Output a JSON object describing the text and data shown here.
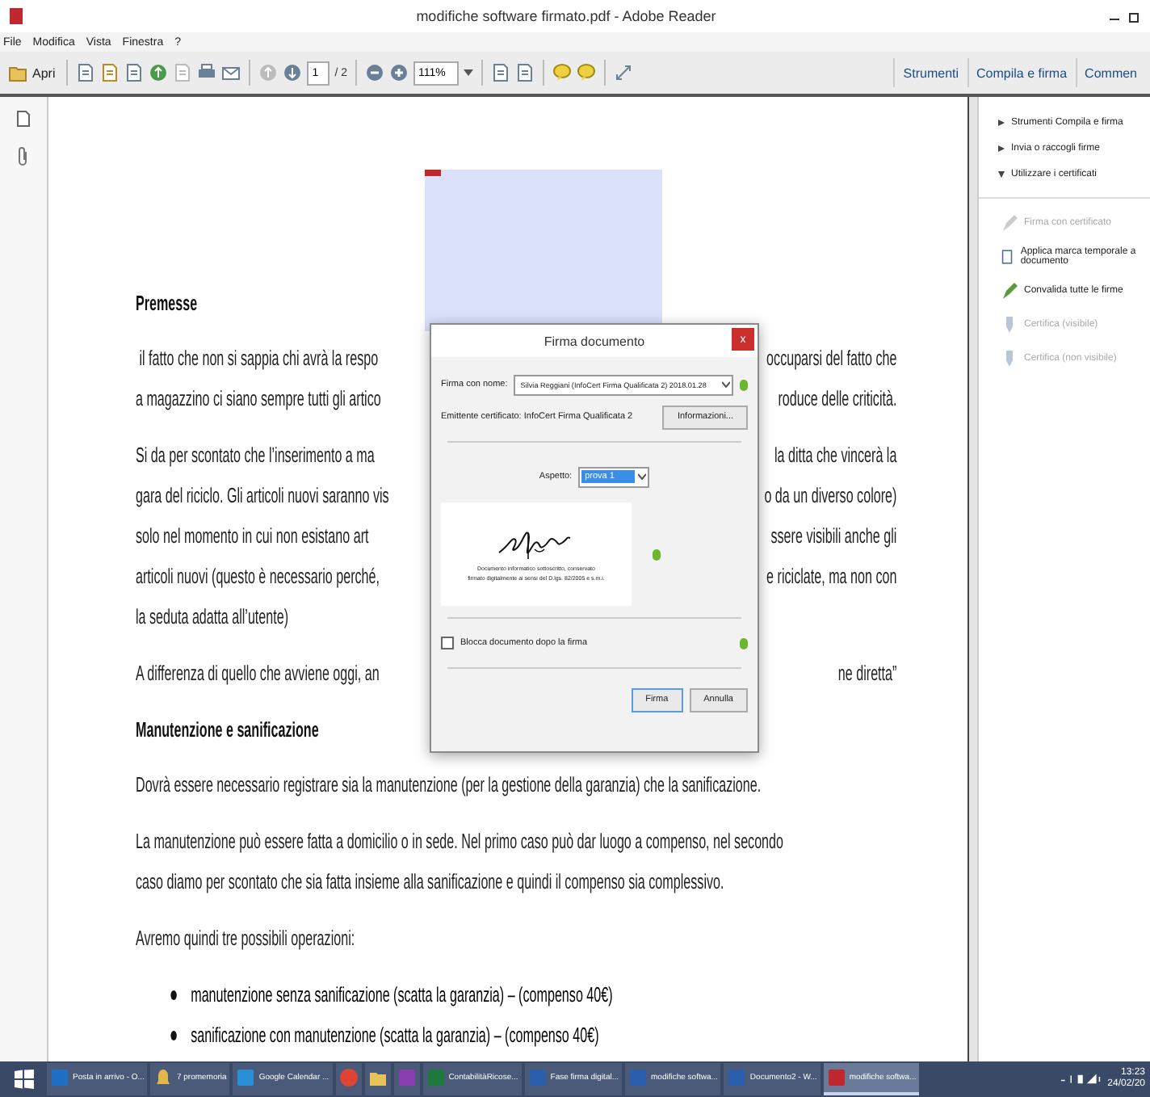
{
  "window": {
    "title": "modifiche software firmato.pdf - Adobe Reader"
  },
  "menu": [
    "File",
    "Modifica",
    "Vista",
    "Finestra",
    "?"
  ],
  "toolbar": {
    "open_label": "Apri",
    "page": "1",
    "page_total": "/ 2",
    "zoom": "111%"
  },
  "panel_tabs": [
    "Strumenti",
    "Compila e firma",
    "Commen"
  ],
  "panel": {
    "sections": [
      {
        "label": "Strumenti Compila e firma",
        "expanded": false
      },
      {
        "label": "Invia o raccogli firme",
        "expanded": false
      },
      {
        "label": "Utilizzare i certificati",
        "expanded": true
      }
    ],
    "tools": [
      {
        "label": "Firma con certificato",
        "disabled": true,
        "kind": "pen"
      },
      {
        "label": "Applica marca temporale a documento",
        "disabled": false,
        "kind": "clock"
      },
      {
        "label": "Convalida tutte le firme",
        "disabled": false,
        "kind": "pen"
      },
      {
        "label": "Certifica (visibile)",
        "disabled": true,
        "kind": "ribbon"
      },
      {
        "label": "Certifica (non visibile)",
        "disabled": true,
        "kind": "ribbon"
      }
    ]
  },
  "document": [
    {
      "kind": "heading",
      "text": "Premesse"
    },
    {
      "kind": "paragraph",
      "lines": [
        {
          "left": " il fatto che non si sappia chi avrà la respo",
          "right": "occuparsi del fatto che"
        },
        {
          "left": "a magazzino ci siano sempre tutti gli artico",
          "right": "roduce delle criticità."
        }
      ]
    },
    {
      "kind": "paragraph",
      "lines": [
        {
          "left": "Si da per scontato che l’inserimento a ma",
          "right": "la ditta che vincerà la"
        },
        {
          "left": "gara del riciclo. Gli articoli nuovi saranno vis",
          "right": "o da un diverso colore)"
        },
        {
          "left": "solo nel momento in cui non esistano art",
          "right": "ssere visibili anche gli"
        },
        {
          "left": "articoli nuovi (questo è necessario perché,",
          "right": "e riciclate, ma non con"
        },
        {
          "left": "la seduta adatta all’utente)"
        }
      ]
    },
    {
      "kind": "paragraph",
      "lines": [
        {
          "left": "A differenza di quello che avviene oggi, an",
          "right": "ne diretta”"
        }
      ]
    },
    {
      "kind": "heading",
      "text": "Manutenzione e sanificazione"
    },
    {
      "kind": "paragraph",
      "lines": [
        {
          "left": "Dovrà essere necessario registrare sia la manutenzione (per la gestione della garanzia) che la sanificazione."
        }
      ]
    },
    {
      "kind": "paragraph",
      "lines": [
        {
          "left": "La manutenzione può essere fatta a domicilio o in sede. Nel primo caso può dar luogo a compenso, nel secondo"
        },
        {
          "left": "caso diamo per scontato che sia fatta insieme alla sanificazione e quindi il compenso sia complessivo."
        }
      ]
    },
    {
      "kind": "paragraph",
      "lines": [
        {
          "left": "Avremo quindi tre possibili operazioni:"
        }
      ]
    },
    {
      "kind": "bullet",
      "text": "manutenzione senza sanificazione (scatta la garanzia) – (compenso 40€)"
    },
    {
      "kind": "bullet",
      "text": "sanificazione con manutenzione (scatta la garanzia) – (compenso 40€)"
    }
  ],
  "dialog": {
    "title": "Firma documento",
    "close": "x",
    "sign_as_label": "Firma con nome:",
    "sign_as": "Silvia Reggiani (InfoCert Firma Qualificata 2) 2018.01.28",
    "issuer": "Emittente certificato: InfoCert Firma Qualificata 2",
    "info_button": "Informazioni...",
    "appearance_label": "Aspetto:",
    "appearance": "prova 1",
    "preview_lines": [
      "Documento informatico sottoscritto, conservato",
      "firmato digitalmente ai sensi del D.lgs. 82/2005 e s.m.i."
    ],
    "lock_label": "Blocca documento dopo la firma",
    "lock_checked": false,
    "buttons": [
      "Firma",
      "Annulla"
    ]
  },
  "taskbar": {
    "apps": [
      {
        "label": "Posta in arrivo - O...",
        "kind": "mail",
        "selected": false
      },
      {
        "label": "7 promemoria",
        "kind": "bell",
        "selected": false
      },
      {
        "label": "Google Calendar ...",
        "kind": "browser",
        "selected": false
      },
      {
        "kind": "globe",
        "selected": false
      },
      {
        "kind": "folder",
        "selected": false
      },
      {
        "kind": "notebook",
        "selected": false
      },
      {
        "label": "ContabilitàRicose...",
        "kind": "sheet",
        "selected": false
      },
      {
        "label": "Fase firma digital...",
        "kind": "doc",
        "selected": false
      },
      {
        "label": "modifiche softwa...",
        "kind": "doc",
        "selected": false
      },
      {
        "label": "Documento2 - W...",
        "kind": "doc",
        "selected": false
      },
      {
        "label": "modifiche softwa...",
        "kind": "pdf",
        "selected": true
      }
    ],
    "time": "13:23",
    "date": "24/02/20"
  }
}
